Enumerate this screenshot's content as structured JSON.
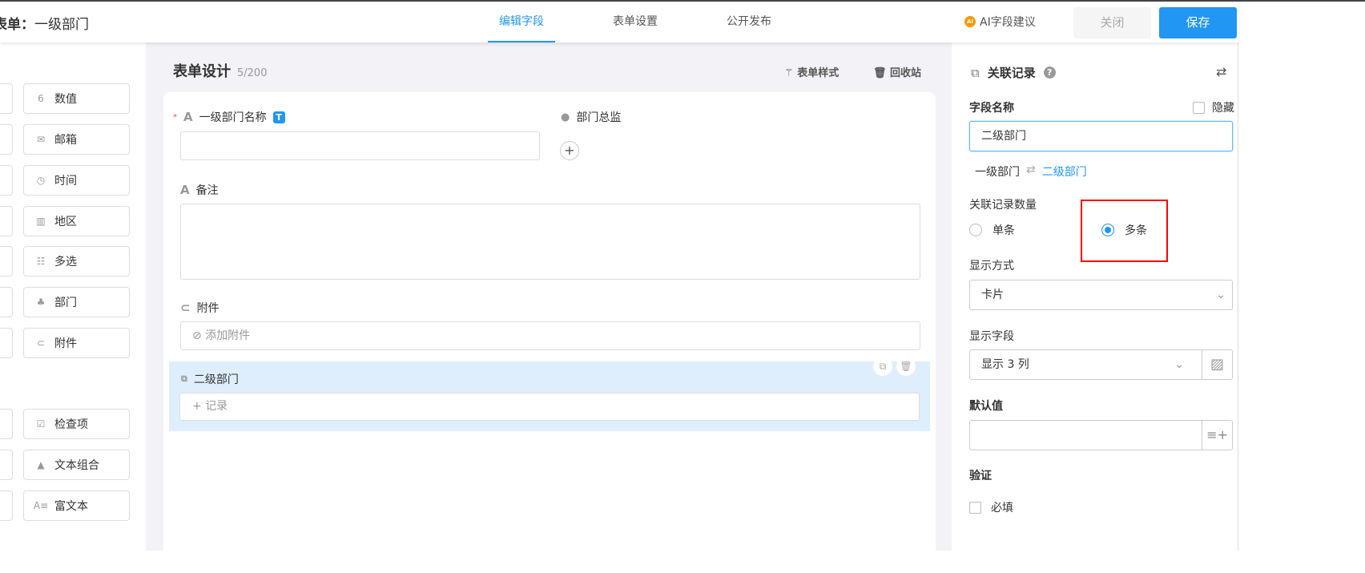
{
  "header": {
    "title_prefix": "表单：",
    "title": "一级部门",
    "tabs": [
      "编辑字段",
      "表单设置",
      "公开发布"
    ],
    "ai_label": "AI字段建议",
    "ai_badge": "AI",
    "close": "关闭",
    "save": "保存"
  },
  "sidebar": {
    "controls": [
      {
        "label": "数值",
        "icon": "number-icon"
      },
      {
        "label": "邮箱",
        "icon": "mail-icon"
      },
      {
        "label": "时间",
        "icon": "clock-icon"
      },
      {
        "label": "地区",
        "icon": "map-icon"
      },
      {
        "label": "多选",
        "icon": "multi-select-icon"
      },
      {
        "label": "部门",
        "icon": "org-icon"
      },
      {
        "label": "附件",
        "icon": "paperclip-icon"
      },
      {
        "label": "检查项",
        "icon": "checkbox-icon"
      },
      {
        "label": "文本组合",
        "icon": "shapes-icon"
      },
      {
        "label": "富文本",
        "icon": "rich-text-icon"
      }
    ]
  },
  "main": {
    "title": "表单设计",
    "count": "5/200",
    "style_btn": "表单样式",
    "recycle_btn": "回收站",
    "fields": {
      "f1": "一级部门名称",
      "f1_badge": "T",
      "f2": "部门总监",
      "f3": "备注",
      "f4": "附件",
      "f4_placeholder": "添加附件",
      "f5": "二级部门",
      "f5_placeholder": "记录"
    }
  },
  "panel": {
    "title": "关联记录",
    "field_name_label": "字段名称",
    "hide_label": "隐藏",
    "field_name_value": "二级部门",
    "rel_from": "一级部门",
    "rel_to": "二级部门",
    "count_label": "关联记录数量",
    "single": "单条",
    "multiple": "多条",
    "display_label": "显示方式",
    "display_value": "卡片",
    "show_fields_label": "显示字段",
    "show_fields_value": "显示 3 列",
    "default_label": "默认值",
    "validate_label": "验证",
    "required_label": "必填"
  }
}
